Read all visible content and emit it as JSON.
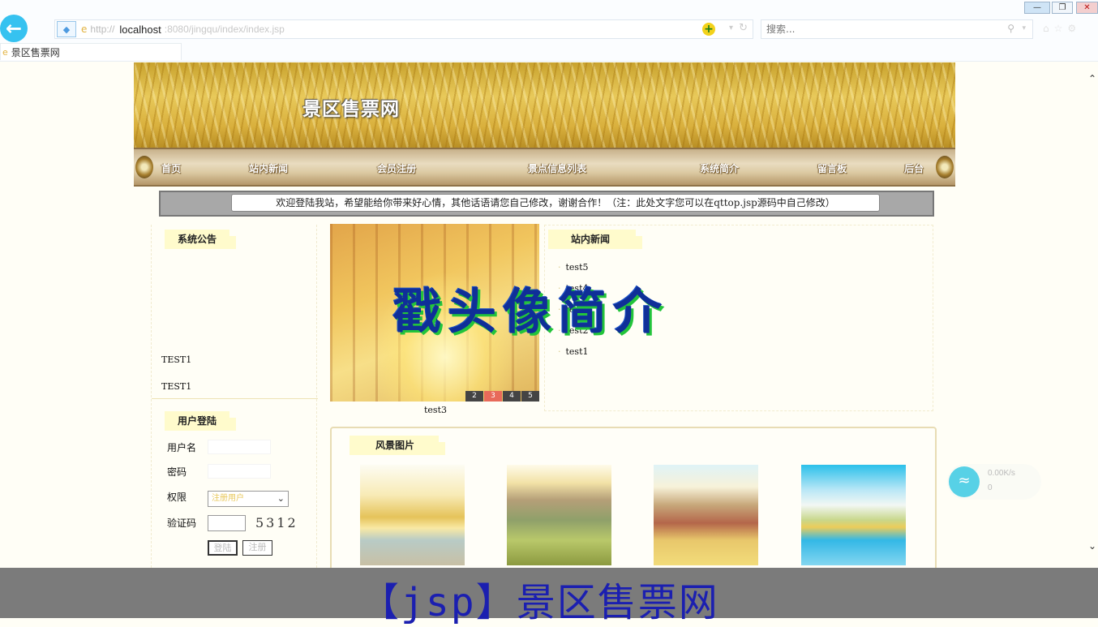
{
  "browser": {
    "url_protocol": "http://",
    "url_host": "localhost",
    "url_rest": ":8080/jingqu/index/index.jsp",
    "search_placeholder": "搜索...",
    "tab_title": "景区售票网",
    "back_icon": "back-arrow-icon"
  },
  "site": {
    "banner_title": "景区售票网",
    "nav": [
      "首页",
      "站内新闻",
      "会员注册",
      "景点信息列表",
      "系统简介",
      "留言板",
      "后台"
    ],
    "welcome": "欢迎登陆我站，希望能给你带来好心情，其他话语请您自己修改，谢谢合作！（注：此处文字您可以在qttop.jsp源码中自己修改）"
  },
  "notice": {
    "title": "系统公告",
    "items": [
      "TEST1",
      "TEST1"
    ]
  },
  "login": {
    "title": "用户登陆",
    "username_label": "用户名",
    "password_label": "密码",
    "role_label": "权限",
    "role_value": "注册用户",
    "captcha_label": "验证码",
    "captcha": "5312",
    "login_button": "登陆",
    "register_button": "注册"
  },
  "slideshow": {
    "pages": [
      "2",
      "3",
      "4",
      "5"
    ],
    "active_page": "3",
    "caption": "test3"
  },
  "news": {
    "title": "站内新闻",
    "items": [
      "test5",
      "test4",
      "test3",
      "test2",
      "test1"
    ]
  },
  "overlay": "戳头像简介",
  "scenery": {
    "title": "风景图片"
  },
  "network": {
    "speed": "0.00K/s",
    "count": "0"
  },
  "footer_title": "【jsp】景区售票网",
  "colors": {
    "nav_bg": "#d9c6a0",
    "overlay_text": "#0f2f98",
    "footer_bg": "#7b7b7b"
  }
}
